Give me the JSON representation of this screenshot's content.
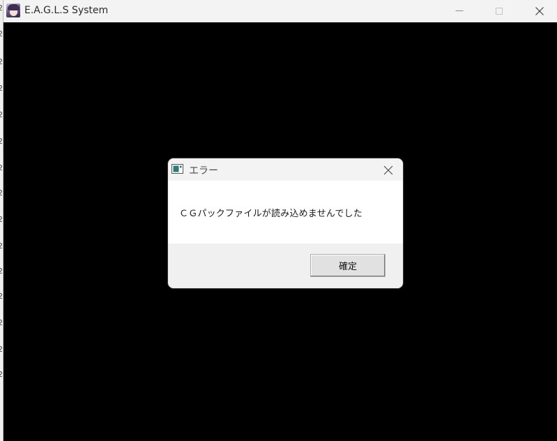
{
  "window": {
    "title": "E.A.G.L.S System",
    "icon": "app-character-icon",
    "controls": {
      "minimize": "minimize-icon",
      "maximize": "maximize-icon",
      "close": "close-icon"
    }
  },
  "dialog": {
    "title": "エラー",
    "icon": "application-window-icon",
    "message": "ＣＧパックファイルが読み込めませんでした",
    "ok_label": "確定",
    "close": "close-icon"
  },
  "colors": {
    "content_background": "#000000",
    "titlebar_background": "#f3f3f3",
    "dialog_footer": "#f0f0f0",
    "button_face": "#e1e1e1"
  }
}
